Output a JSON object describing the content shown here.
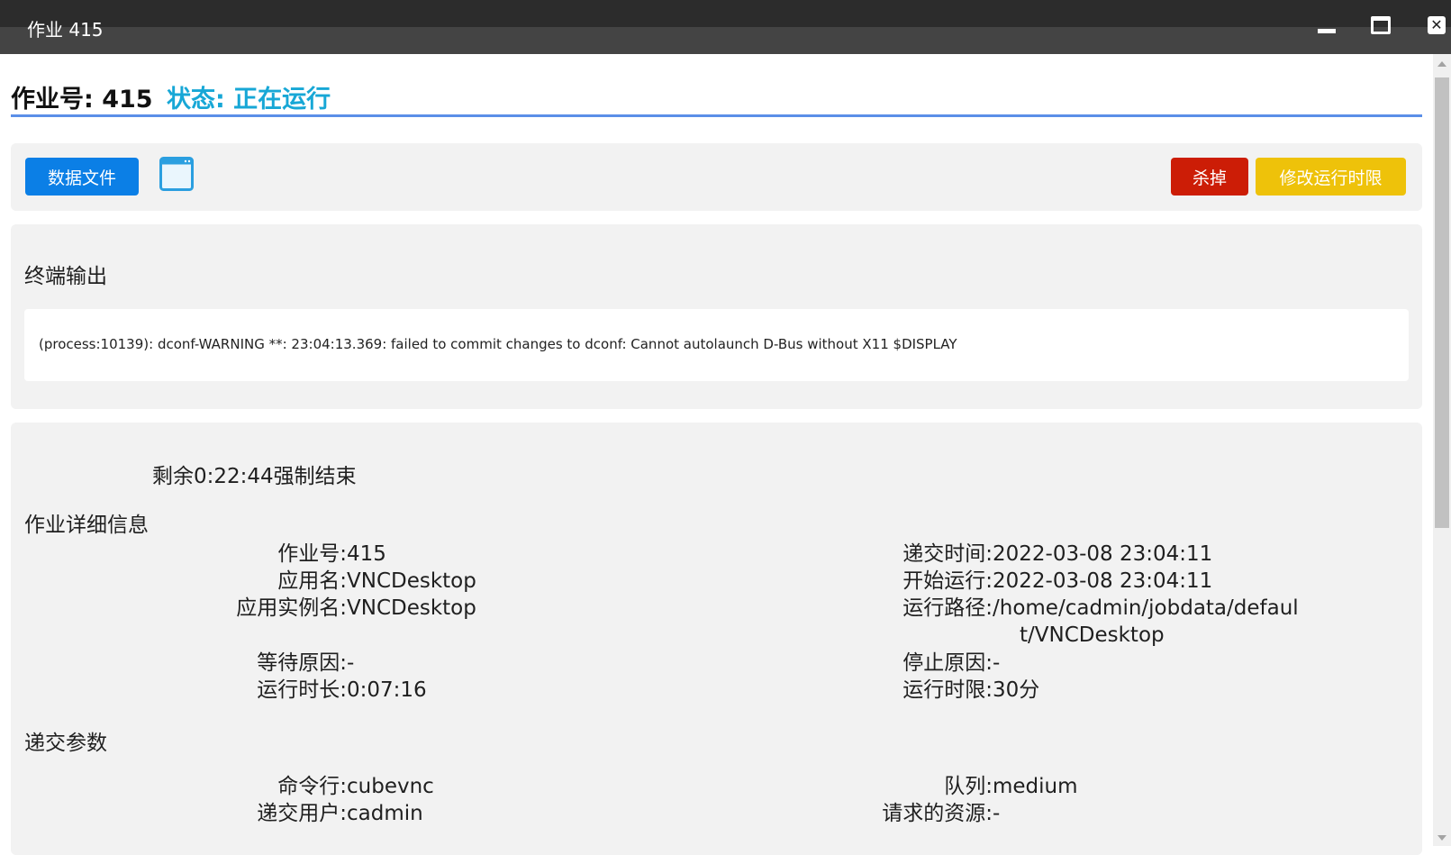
{
  "window": {
    "title": "作业 415",
    "minimize_icon": "minimize-icon",
    "maximize_icon": "maximize-icon",
    "close_icon": "close-icon",
    "close_glyph": "✕"
  },
  "header": {
    "job_label": "作业号: 415",
    "status_label": "状态: 正在运行",
    "status_color": "#17a7d6",
    "rule_color": "#5b8fe8"
  },
  "toolbar": {
    "data_file_button": "数据文件",
    "window_icon": "window-icon",
    "kill_button": "杀掉",
    "change_limit_button": "修改运行时限",
    "colors": {
      "data_file": "#0b7fe6",
      "kill": "#cc1d06",
      "change_limit": "#eec20a"
    }
  },
  "terminal": {
    "title": "终端输出",
    "output": "(process:10139): dconf-WARNING **: 23:04:13.369: failed to commit changes to dconf: Cannot autolaunch D-Bus without X11 $DISPLAY"
  },
  "details": {
    "remaining": "剩余0:22:44强制结束",
    "title": "作业详细信息",
    "fields_left": [
      {
        "key": "作业号:",
        "value": "415"
      },
      {
        "key": "应用名:",
        "value": "VNCDesktop"
      },
      {
        "key": "应用实例名:",
        "value": "VNCDesktop"
      },
      {
        "key": "等待原因:",
        "value": "-"
      },
      {
        "key": "运行时长:",
        "value": "0:07:16"
      }
    ],
    "fields_right": [
      {
        "key": "递交时间:",
        "value": "2022-03-08 23:04:11"
      },
      {
        "key": "开始运行:",
        "value": "2022-03-08 23:04:11"
      },
      {
        "key": "运行路径:",
        "value": "/home/cadmin/jobdata/defaul"
      },
      {
        "key": "",
        "value": "t/VNCDesktop"
      },
      {
        "key": "停止原因:",
        "value": "-"
      },
      {
        "key": "运行时限:",
        "value": "30分"
      }
    ]
  },
  "submit_params": {
    "title": "递交参数",
    "fields_left": [
      {
        "key": "命令行:",
        "value": "cubevnc"
      },
      {
        "key": "递交用户:",
        "value": "cadmin"
      }
    ],
    "fields_right": [
      {
        "key": "队列:",
        "value": "medium"
      },
      {
        "key": "请求的资源:",
        "value": "-"
      }
    ]
  }
}
